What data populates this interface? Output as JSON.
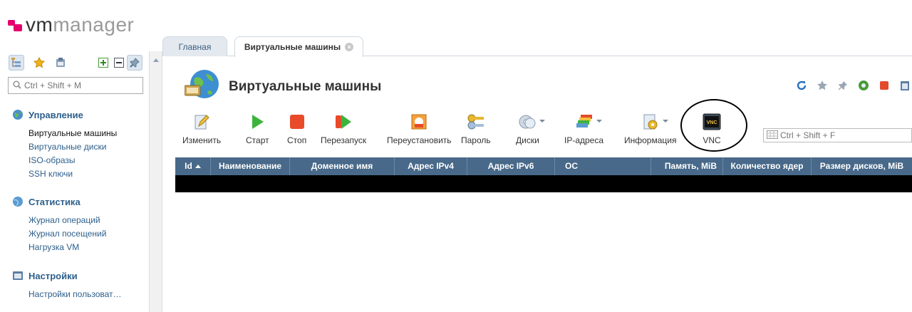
{
  "logo": {
    "part1": "vm",
    "part2": "manager"
  },
  "sidebar": {
    "search_placeholder": "Ctrl + Shift + M",
    "groups": [
      {
        "title": "Управление",
        "icon": "globe-icon",
        "items": [
          "Виртуальные машины",
          "Виртуальные диски",
          "ISO-образы",
          "SSH ключи"
        ],
        "current": 0
      },
      {
        "title": "Статистика",
        "icon": "chart-icon",
        "items": [
          "Журнал операций",
          "Журнал посещений",
          "Нагрузка VM"
        ]
      },
      {
        "title": "Настройки",
        "icon": "settings-icon",
        "items": [
          "Настройки пользоват…"
        ]
      }
    ]
  },
  "tabs": [
    {
      "label": "Главная",
      "active": false
    },
    {
      "label": "Виртуальные машины",
      "active": true
    }
  ],
  "page": {
    "title": "Виртуальные машины"
  },
  "toolbar": {
    "edit": "Изменить",
    "start": "Старт",
    "stop": "Стоп",
    "restart": "Перезапуск",
    "reinstall": "Переустановить",
    "password": "Пароль",
    "disks": "Диски",
    "ip": "IP-адреса",
    "info": "Информация",
    "vnc": "VNC",
    "vnc_icon_text": "VNC"
  },
  "grid_search_placeholder": "Ctrl + Shift + F",
  "table": {
    "columns": [
      "Id",
      "Наименование",
      "Доменное имя",
      "Адрес IPv4",
      "Адрес IPv6",
      "ОС",
      "Память, MiB",
      "Количество ядер",
      "Размер дисков, MiB"
    ]
  },
  "colors": {
    "accent": "#e5006e",
    "header": "#486989",
    "link": "#2d5f8b"
  }
}
